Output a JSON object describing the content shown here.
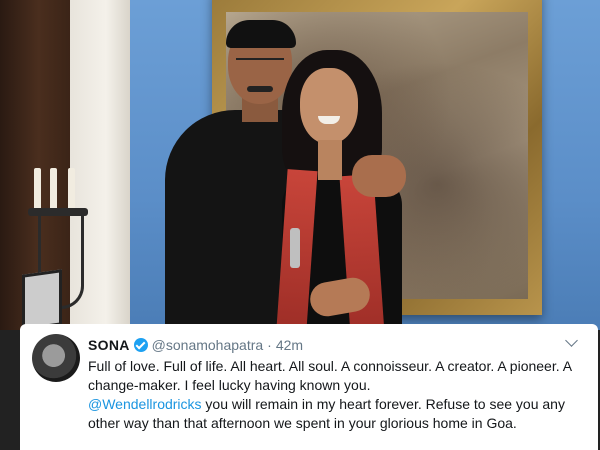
{
  "tweet": {
    "author": {
      "display_name": "SONA",
      "handle": "@sonamohapatra",
      "verified": true,
      "avatar": "profile-photo"
    },
    "separator": "·",
    "timestamp": "42m",
    "menu_icon": "chevron-down-icon",
    "text": {
      "line_block_1": "Full of love. Full of life. All heart. All soul. A connoisseur. A creator. A pioneer. A change-maker. I feel lucky having known you.",
      "mention": "@Wendellrodricks",
      "line_block_2": " you will remain in my heart forever. Refuse to see you any other way than that afternoon we spent in your glorious home in Goa."
    }
  },
  "colors": {
    "text_primary": "#14171a",
    "text_secondary": "#657786",
    "link": "#1b95e0",
    "verified_badge": "#1da1f2",
    "wall_blue": "#5b8ec8",
    "scarf_red": "#c8453a"
  }
}
